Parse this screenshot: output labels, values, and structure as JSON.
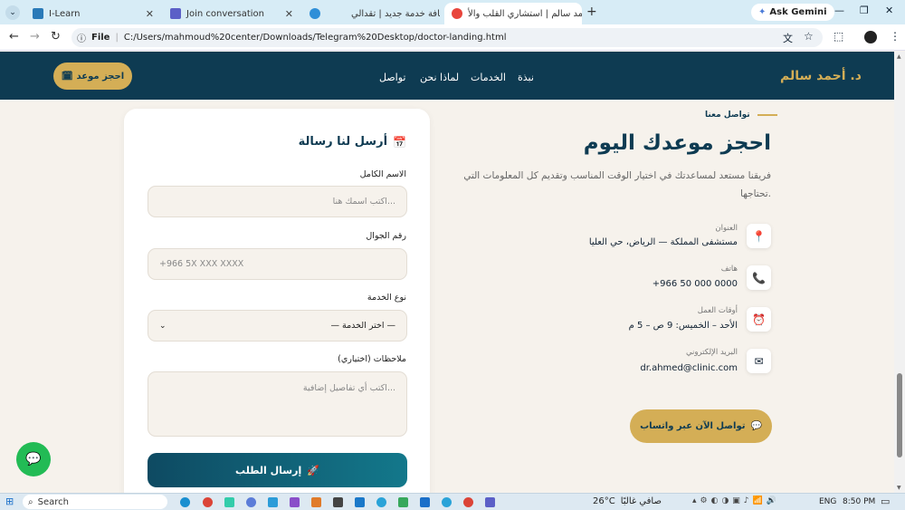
{
  "browser": {
    "tabs": [
      {
        "title": "I-Learn",
        "color": "#2a7ab8"
      },
      {
        "title": "Join conversation",
        "color": "#5b5fc7"
      },
      {
        "title": "إضافة خدمة جديد | تقدالي",
        "color": "#2f8fd8"
      },
      {
        "title": "د. أحمد سالم | استشاري القلب والأ",
        "color": "#e8453c"
      }
    ],
    "new_tab_icon": "plus-icon",
    "ask_gemini": "Ask Gemini",
    "address_scheme": "File",
    "address_url": "C:/Users/mahmoud%20center/Downloads/Telegram%20Desktop/doctor-landing.html"
  },
  "header": {
    "logo": "د. أحمد سالم",
    "nav": [
      "نبذة",
      "الخدمات",
      "لماذا نحن",
      "تواصل"
    ],
    "book_label": "احجز موعد",
    "book_icon": "🗓"
  },
  "contact": {
    "eyebrow": "تواصل معنا",
    "title": "احجز موعدك اليوم",
    "subtitle_line1": "فريقنا مستعد لمساعدتك في اختيار الوقت المناسب وتقديم كل المعلومات التي",
    "subtitle_line2": "تحتاجها.",
    "items": [
      {
        "label": "العنوان",
        "value": "مستشفى المملكة — الرياض، حي العليا",
        "icon": "📍"
      },
      {
        "label": "هاتف",
        "value": "+966 50 000 0000",
        "icon": "📞"
      },
      {
        "label": "أوقات العمل",
        "value": "الأحد – الخميس: 9 ص – 5 م",
        "icon": "⏰"
      },
      {
        "label": "البريد الإلكتروني",
        "value": "dr.ahmed@clinic.com",
        "icon": "✉"
      }
    ],
    "whatsapp_label": "تواصل الآن عبر واتساب",
    "whatsapp_icon": "💬"
  },
  "form": {
    "title": "أرسل لنا رسالة",
    "title_icon": "📅",
    "name_label": "الاسم الكامل",
    "name_placeholder": "اكتب اسمك هنا...",
    "phone_label": "رقم الجوال",
    "phone_placeholder": "+966 5X XXX XXXX",
    "service_label": "نوع الخدمة",
    "service_selected": "— اختر الخدمة —",
    "notes_label": "ملاحظات (اختياري)",
    "notes_placeholder": "اكتب أي تفاصيل إضافية...",
    "submit_label": "إرسال الطلب",
    "submit_icon": "🚀"
  },
  "taskbar": {
    "search": "Search",
    "weather_temp": "26°C",
    "weather_text": "صافي غالبًا",
    "lang": "ENG",
    "time": "8:50 PM"
  },
  "colors": {
    "navy": "#0e3b52",
    "gold": "#d4ae56",
    "cream": "#f6f2ec",
    "whatsapp_green": "#22bb55"
  }
}
